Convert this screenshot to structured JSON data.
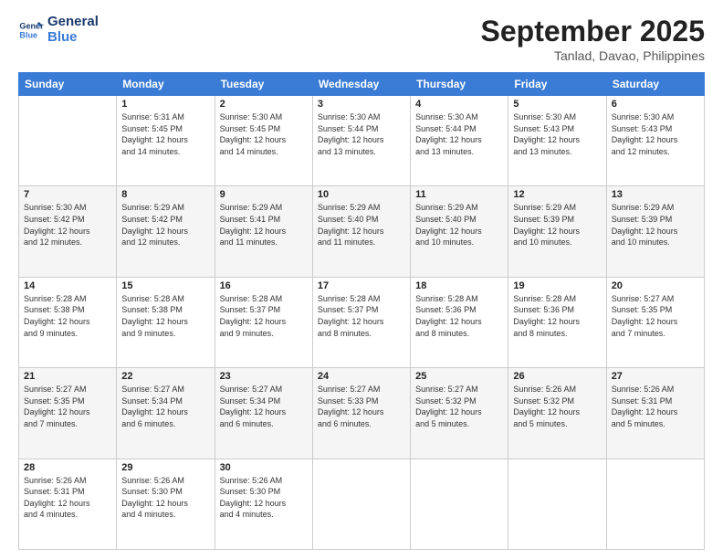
{
  "logo": {
    "line1": "General",
    "line2": "Blue"
  },
  "header": {
    "title": "September 2025",
    "subtitle": "Tanlad, Davao, Philippines"
  },
  "weekdays": [
    "Sunday",
    "Monday",
    "Tuesday",
    "Wednesday",
    "Thursday",
    "Friday",
    "Saturday"
  ],
  "weeks": [
    [
      {
        "day": "",
        "info": ""
      },
      {
        "day": "1",
        "info": "Sunrise: 5:31 AM\nSunset: 5:45 PM\nDaylight: 12 hours\nand 14 minutes."
      },
      {
        "day": "2",
        "info": "Sunrise: 5:30 AM\nSunset: 5:45 PM\nDaylight: 12 hours\nand 14 minutes."
      },
      {
        "day": "3",
        "info": "Sunrise: 5:30 AM\nSunset: 5:44 PM\nDaylight: 12 hours\nand 13 minutes."
      },
      {
        "day": "4",
        "info": "Sunrise: 5:30 AM\nSunset: 5:44 PM\nDaylight: 12 hours\nand 13 minutes."
      },
      {
        "day": "5",
        "info": "Sunrise: 5:30 AM\nSunset: 5:43 PM\nDaylight: 12 hours\nand 13 minutes."
      },
      {
        "day": "6",
        "info": "Sunrise: 5:30 AM\nSunset: 5:43 PM\nDaylight: 12 hours\nand 12 minutes."
      }
    ],
    [
      {
        "day": "7",
        "info": "Sunrise: 5:30 AM\nSunset: 5:42 PM\nDaylight: 12 hours\nand 12 minutes."
      },
      {
        "day": "8",
        "info": "Sunrise: 5:29 AM\nSunset: 5:42 PM\nDaylight: 12 hours\nand 12 minutes."
      },
      {
        "day": "9",
        "info": "Sunrise: 5:29 AM\nSunset: 5:41 PM\nDaylight: 12 hours\nand 11 minutes."
      },
      {
        "day": "10",
        "info": "Sunrise: 5:29 AM\nSunset: 5:40 PM\nDaylight: 12 hours\nand 11 minutes."
      },
      {
        "day": "11",
        "info": "Sunrise: 5:29 AM\nSunset: 5:40 PM\nDaylight: 12 hours\nand 10 minutes."
      },
      {
        "day": "12",
        "info": "Sunrise: 5:29 AM\nSunset: 5:39 PM\nDaylight: 12 hours\nand 10 minutes."
      },
      {
        "day": "13",
        "info": "Sunrise: 5:29 AM\nSunset: 5:39 PM\nDaylight: 12 hours\nand 10 minutes."
      }
    ],
    [
      {
        "day": "14",
        "info": "Sunrise: 5:28 AM\nSunset: 5:38 PM\nDaylight: 12 hours\nand 9 minutes."
      },
      {
        "day": "15",
        "info": "Sunrise: 5:28 AM\nSunset: 5:38 PM\nDaylight: 12 hours\nand 9 minutes."
      },
      {
        "day": "16",
        "info": "Sunrise: 5:28 AM\nSunset: 5:37 PM\nDaylight: 12 hours\nand 9 minutes."
      },
      {
        "day": "17",
        "info": "Sunrise: 5:28 AM\nSunset: 5:37 PM\nDaylight: 12 hours\nand 8 minutes."
      },
      {
        "day": "18",
        "info": "Sunrise: 5:28 AM\nSunset: 5:36 PM\nDaylight: 12 hours\nand 8 minutes."
      },
      {
        "day": "19",
        "info": "Sunrise: 5:28 AM\nSunset: 5:36 PM\nDaylight: 12 hours\nand 8 minutes."
      },
      {
        "day": "20",
        "info": "Sunrise: 5:27 AM\nSunset: 5:35 PM\nDaylight: 12 hours\nand 7 minutes."
      }
    ],
    [
      {
        "day": "21",
        "info": "Sunrise: 5:27 AM\nSunset: 5:35 PM\nDaylight: 12 hours\nand 7 minutes."
      },
      {
        "day": "22",
        "info": "Sunrise: 5:27 AM\nSunset: 5:34 PM\nDaylight: 12 hours\nand 6 minutes."
      },
      {
        "day": "23",
        "info": "Sunrise: 5:27 AM\nSunset: 5:34 PM\nDaylight: 12 hours\nand 6 minutes."
      },
      {
        "day": "24",
        "info": "Sunrise: 5:27 AM\nSunset: 5:33 PM\nDaylight: 12 hours\nand 6 minutes."
      },
      {
        "day": "25",
        "info": "Sunrise: 5:27 AM\nSunset: 5:32 PM\nDaylight: 12 hours\nand 5 minutes."
      },
      {
        "day": "26",
        "info": "Sunrise: 5:26 AM\nSunset: 5:32 PM\nDaylight: 12 hours\nand 5 minutes."
      },
      {
        "day": "27",
        "info": "Sunrise: 5:26 AM\nSunset: 5:31 PM\nDaylight: 12 hours\nand 5 minutes."
      }
    ],
    [
      {
        "day": "28",
        "info": "Sunrise: 5:26 AM\nSunset: 5:31 PM\nDaylight: 12 hours\nand 4 minutes."
      },
      {
        "day": "29",
        "info": "Sunrise: 5:26 AM\nSunset: 5:30 PM\nDaylight: 12 hours\nand 4 minutes."
      },
      {
        "day": "30",
        "info": "Sunrise: 5:26 AM\nSunset: 5:30 PM\nDaylight: 12 hours\nand 4 minutes."
      },
      {
        "day": "",
        "info": ""
      },
      {
        "day": "",
        "info": ""
      },
      {
        "day": "",
        "info": ""
      },
      {
        "day": "",
        "info": ""
      }
    ]
  ]
}
